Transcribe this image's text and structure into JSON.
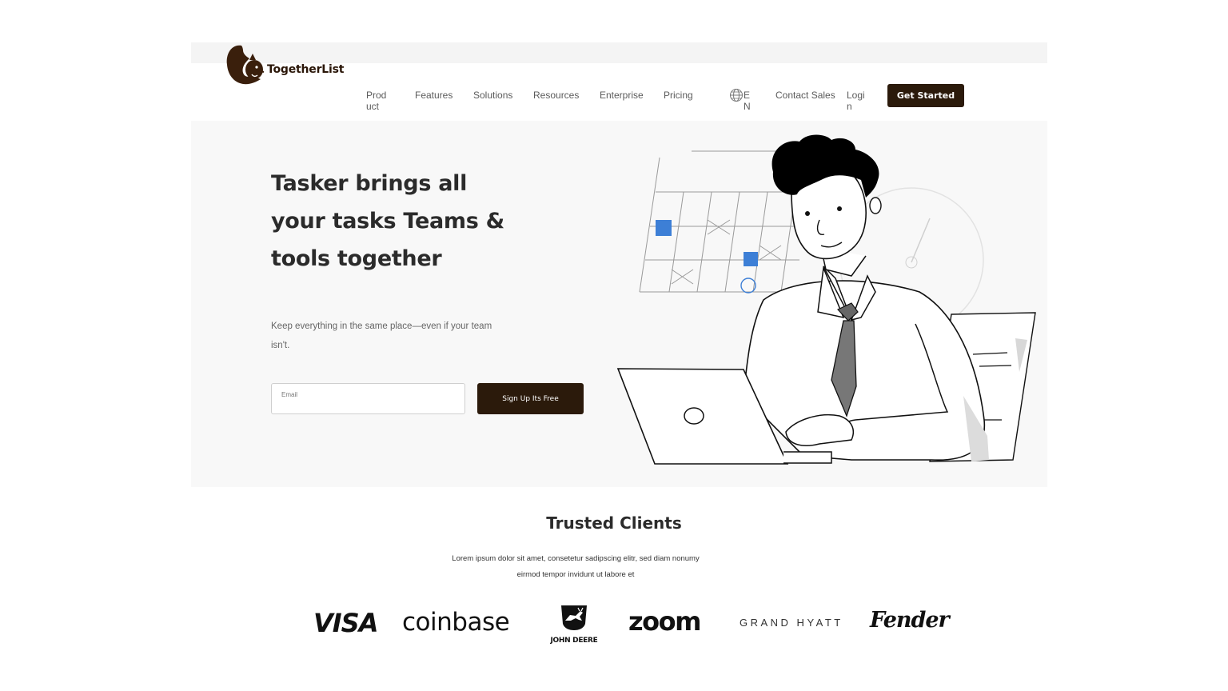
{
  "brand": {
    "name": "TogetherList",
    "color": "#2b1a0b"
  },
  "nav": {
    "items": [
      {
        "id": "product",
        "label": "Product"
      },
      {
        "id": "features",
        "label": "Features"
      },
      {
        "id": "solutions",
        "label": "Solutions"
      },
      {
        "id": "resources",
        "label": "Resources"
      },
      {
        "id": "enterprise",
        "label": "Enterprise"
      },
      {
        "id": "pricing",
        "label": "Pricing"
      }
    ],
    "language": "EN",
    "contact_sales": "Contact Sales",
    "login": "Login",
    "cta": "Get Started"
  },
  "hero": {
    "headline": "Tasker brings all your tasks Teams & tools together",
    "subtitle": "Keep everything in the same place—even if your team isn't.",
    "email_placeholder": "Email",
    "signup_label": "Sign Up Its Free"
  },
  "trusted": {
    "title": "Trusted Clients",
    "description": "Lorem ipsum dolor sit amet, consetetur sadipscing elitr, sed diam nonumy eirmod tempor invidunt ut labore et",
    "clients": [
      "VISA",
      "coinbase",
      "JOHN DEERE",
      "zoom",
      "GRAND HYATT",
      "Fender"
    ]
  },
  "icons": {
    "language": "globe-icon",
    "brand": "squirrel-logo-icon"
  }
}
